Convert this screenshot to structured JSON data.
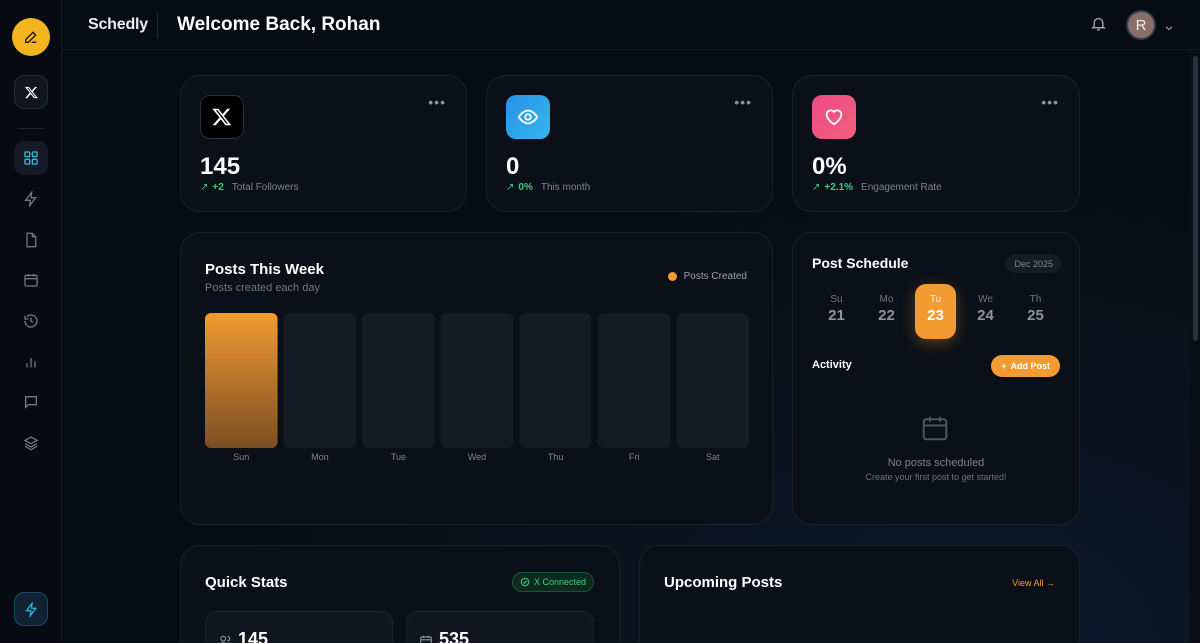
{
  "app": {
    "brand": "Schedly",
    "welcome": "Welcome Back, Rohan"
  },
  "user": {
    "avatar_initial": "R"
  },
  "sidebar": {
    "items": [
      {
        "icon": "grid-icon",
        "active": true
      },
      {
        "icon": "lightning-icon"
      },
      {
        "icon": "document-icon"
      },
      {
        "icon": "calendar-icon"
      },
      {
        "icon": "history-icon"
      },
      {
        "icon": "bar-chart-icon"
      },
      {
        "icon": "message-icon"
      },
      {
        "icon": "layers-icon"
      }
    ]
  },
  "stats": [
    {
      "icon": "x-logo-icon",
      "value": "145",
      "arrow": "↗",
      "delta": "+2",
      "label": "Total Followers",
      "color": "#000000"
    },
    {
      "icon": "eye-icon",
      "value": "0",
      "arrow": "↗",
      "delta": "0%",
      "label": "This month",
      "color": "#2a8fe8"
    },
    {
      "icon": "heart-icon",
      "value": "0%",
      "arrow": "↗",
      "delta": "+2.1%",
      "label": "Engagement Rate",
      "color": "#ec4a86"
    }
  ],
  "posts_week": {
    "title": "Posts This Week",
    "subtitle": "Posts created each day",
    "legend": "Posts Created"
  },
  "chart_data": {
    "type": "bar",
    "categories": [
      "Sun",
      "Mon",
      "Tue",
      "Wed",
      "Thu",
      "Fri",
      "Sat"
    ],
    "series": [
      {
        "name": "Posts Created",
        "values": [
          1,
          0,
          0,
          0,
          0,
          0,
          0
        ]
      }
    ],
    "title": "Posts This Week",
    "subtitle": "Posts created each day",
    "legend_position": "top-right",
    "colors": {
      "bar": "#ef9a33",
      "track": "#151a23"
    }
  },
  "schedule": {
    "title": "Post Schedule",
    "month": "Dec 2025",
    "days": [
      {
        "name": "Su",
        "date": "21"
      },
      {
        "name": "Mo",
        "date": "22"
      },
      {
        "name": "Tu",
        "date": "23",
        "active": true
      },
      {
        "name": "We",
        "date": "24"
      },
      {
        "name": "Th",
        "date": "25"
      }
    ],
    "activity_label": "Activity",
    "add_post": "Add Post",
    "empty_title": "No posts scheduled",
    "empty_sub": "Create your first post to get started!"
  },
  "quick_stats": {
    "title": "Quick Stats",
    "connected": "X Connected",
    "items": [
      {
        "icon": "users-icon",
        "value": "145"
      },
      {
        "icon": "calendar-icon",
        "value": "535"
      }
    ]
  },
  "upcoming": {
    "title": "Upcoming Posts",
    "view_all": "View All →"
  },
  "colors": {
    "accent": "#f29b32",
    "success": "#3fcf7f",
    "bg": "#070b12",
    "card": "#0b0f17"
  }
}
